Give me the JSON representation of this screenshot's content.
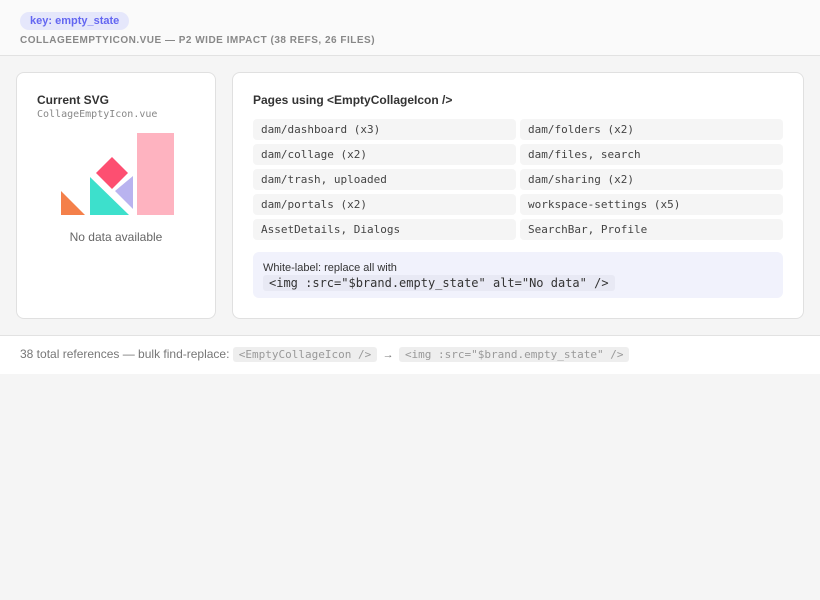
{
  "header": {
    "badge": "key: empty_state",
    "subtitle": "CollageEmptyIcon.vue — P2 wide impact (38 refs, 26 files)"
  },
  "svg_card": {
    "title": "Current SVG",
    "filename": "CollageEmptyIcon.vue",
    "empty_text": "No data available",
    "illustration_colors": {
      "orange": "#f4804a",
      "teal": "#3de0cc",
      "pink": "#fd4f71",
      "lavender": "#b9b3ef",
      "light_pink": "#feb3c0"
    }
  },
  "pages_card": {
    "title": "Pages using <EmptyCollageIcon />",
    "pages": [
      "dam/dashboard (x3)",
      "dam/folders (x2)",
      "dam/collage (x2)",
      "dam/files, search",
      "dam/trash, uploaded",
      "dam/sharing (x2)",
      "dam/portals (x2)",
      "workspace-settings (x5)",
      "AssetDetails, Dialogs",
      "SearchBar, Profile"
    ],
    "whitelabel_text": "White-label: replace all with",
    "whitelabel_code": "<img :src=\"$brand.empty_state\" alt=\"No data\" />"
  },
  "footer": {
    "text": "38 total references — bulk find-replace:",
    "from_code": "<EmptyCollageIcon />",
    "arrow": "→",
    "to_code": "<img :src=\"$brand.empty_state\" />"
  }
}
